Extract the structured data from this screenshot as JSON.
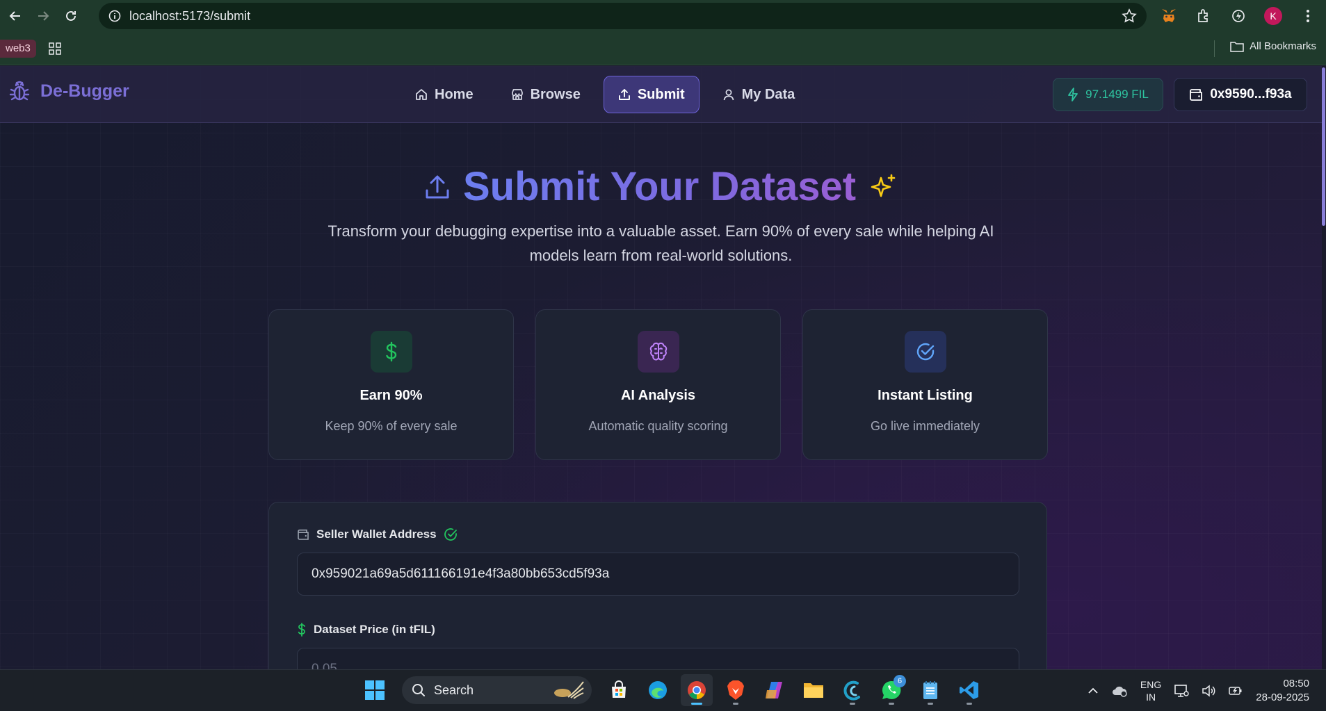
{
  "browser": {
    "url": "localhost:5173/submit",
    "bookmark_chip": "web3",
    "all_bookmarks": "All Bookmarks",
    "profile_initial": "K"
  },
  "header": {
    "brand": "De-Bugger",
    "nav": [
      {
        "label": "Home",
        "icon": "home-icon"
      },
      {
        "label": "Browse",
        "icon": "store-icon"
      },
      {
        "label": "Submit",
        "icon": "upload-icon",
        "active": true
      },
      {
        "label": "My Data",
        "icon": "user-icon"
      }
    ],
    "balance": "97.1499 FIL",
    "wallet": "0x9590...f93a"
  },
  "hero": {
    "title": "Submit Your Dataset",
    "subtitle": "Transform your debugging expertise into a valuable asset. Earn 90% of every sale while helping AI models learn from real-world solutions."
  },
  "features": [
    {
      "title": "Earn 90%",
      "desc": "Keep 90% of every sale",
      "icon": "dollar-icon",
      "color": "#22c55e"
    },
    {
      "title": "AI Analysis",
      "desc": "Automatic quality scoring",
      "icon": "brain-icon",
      "color": "#c084fc"
    },
    {
      "title": "Instant Listing",
      "desc": "Go live immediately",
      "icon": "check-circle-icon",
      "color": "#60a5fa"
    }
  ],
  "form": {
    "wallet_label": "Seller Wallet Address",
    "wallet_value": "0x959021a69a5d611166191e4f3a80bb653cd5f93a",
    "price_label": "Dataset Price (in tFIL)",
    "price_placeholder": "0.05"
  },
  "taskbar": {
    "search_label": "Search",
    "whatsapp_badge": "6",
    "lang_top": "ENG",
    "lang_bottom": "IN",
    "time": "08:50",
    "date": "28-09-2025"
  }
}
